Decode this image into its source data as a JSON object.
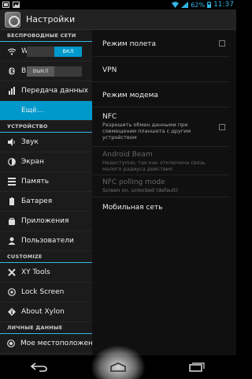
{
  "status_bar": {
    "battery_percent": "62%",
    "time": "11:37",
    "icons": [
      "screenshot-icon",
      "image-icon",
      "wifi-icon",
      "signal-icon",
      "battery-icon"
    ]
  },
  "action_bar": {
    "title": "Настройки"
  },
  "left_pane": {
    "sections": [
      {
        "header": "БЕСПРОВОДНЫЕ СЕТИ",
        "items": [
          {
            "icon": "wifi-icon",
            "label": "W",
            "toggle": "ВКЛ",
            "toggle_state": "on"
          },
          {
            "icon": "bluetooth-icon",
            "label": "B",
            "toggle": "ВЫКЛ",
            "toggle_state": "off"
          },
          {
            "icon": "data-transfer-icon",
            "label": "Передача данных"
          },
          {
            "icon": "",
            "label": "Ещё...",
            "selected": true
          }
        ]
      },
      {
        "header": "УСТРОЙСТВО",
        "items": [
          {
            "icon": "sound-icon",
            "label": "Звук"
          },
          {
            "icon": "display-icon",
            "label": "Экран"
          },
          {
            "icon": "storage-icon",
            "label": "Память"
          },
          {
            "icon": "battery-icon",
            "label": "Батарея"
          },
          {
            "icon": "apps-icon",
            "label": "Приложения"
          },
          {
            "icon": "users-icon",
            "label": "Пользователи"
          }
        ]
      },
      {
        "header": "CUSTOMIZE",
        "items": [
          {
            "icon": "tools-icon",
            "label": "XY Tools"
          },
          {
            "icon": "lock-icon",
            "label": "Lock Screen"
          },
          {
            "icon": "info-icon",
            "label": "About Xylon"
          }
        ]
      },
      {
        "header": "ЛИЧНЫЕ ДАННЫЕ",
        "items": [
          {
            "icon": "location-icon",
            "label": "Мое местоположение"
          }
        ]
      }
    ]
  },
  "right_pane": {
    "items": [
      {
        "title": "Режим полета",
        "subtitle": "",
        "checkbox": true,
        "enabled": true
      },
      {
        "title": "VPN",
        "subtitle": "",
        "checkbox": false,
        "enabled": true
      },
      {
        "title": "Режим модема",
        "subtitle": "",
        "checkbox": false,
        "enabled": true
      },
      {
        "title": "NFC",
        "subtitle": "Разрешить обмен данными при совмещении планшета с другим устройством",
        "checkbox": true,
        "enabled": true
      },
      {
        "title": "Android Beam",
        "subtitle": "Недоступно, так как отключена связь малого радиуса действия",
        "checkbox": false,
        "enabled": false
      },
      {
        "title": "NFC polling mode",
        "subtitle": "Screen on, unlocked (default)",
        "checkbox": false,
        "enabled": false
      },
      {
        "title": "Мобильная сеть",
        "subtitle": "",
        "checkbox": false,
        "enabled": true
      }
    ]
  },
  "nav_bar": {
    "buttons": [
      "back-icon",
      "home-icon",
      "recents-icon"
    ]
  },
  "colors": {
    "accent": "#33b5e5",
    "selected": "#0099cc"
  }
}
